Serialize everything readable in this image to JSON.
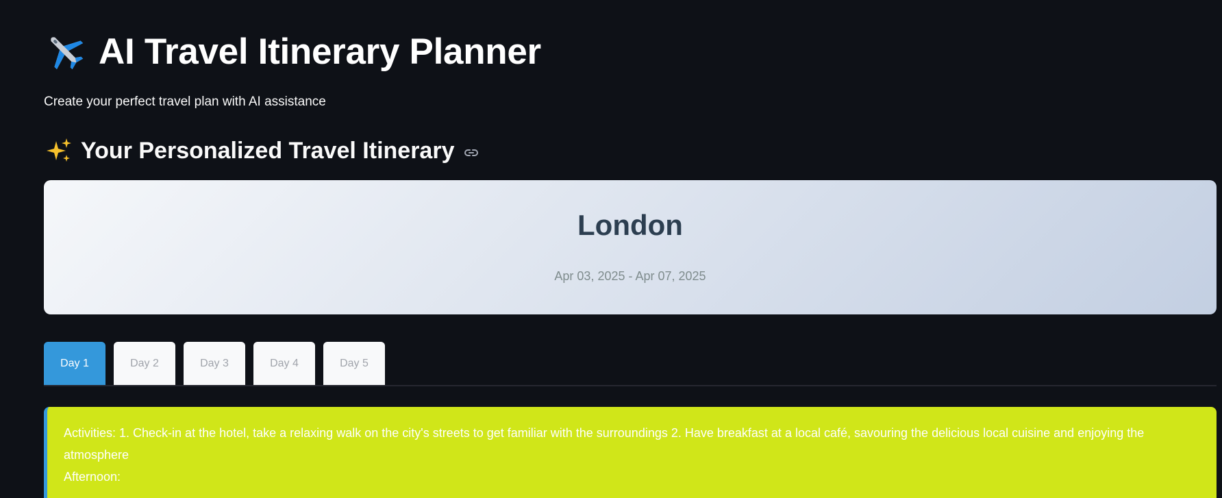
{
  "header": {
    "title": "AI Travel Itinerary Planner",
    "subtitle": "Create your perfect travel plan with AI assistance",
    "title_icon": "airplane-icon"
  },
  "section": {
    "heading": "Your Personalized Travel Itinerary",
    "heading_icon": "sparkles-icon",
    "anchor_icon": "link-icon"
  },
  "trip": {
    "destination": "London",
    "dates": "Apr 03, 2025 - Apr 07, 2025"
  },
  "tabs": [
    {
      "label": "Day 1",
      "active": true
    },
    {
      "label": "Day 2",
      "active": false
    },
    {
      "label": "Day 3",
      "active": false
    },
    {
      "label": "Day 4",
      "active": false
    },
    {
      "label": "Day 5",
      "active": false
    }
  ],
  "day_content": {
    "activities": "Activities: 1. Check-in at the hotel, take a relaxing walk on the city's streets to get familiar with the surroundings 2. Have breakfast at a local café, savouring the delicious local cuisine and enjoying the atmosphere",
    "afternoon": "Afternoon:"
  },
  "colors": {
    "background": "#0e1117",
    "active_tab": "#3498db",
    "day_card": "#d0e619",
    "hero_title": "#2c3e50"
  }
}
